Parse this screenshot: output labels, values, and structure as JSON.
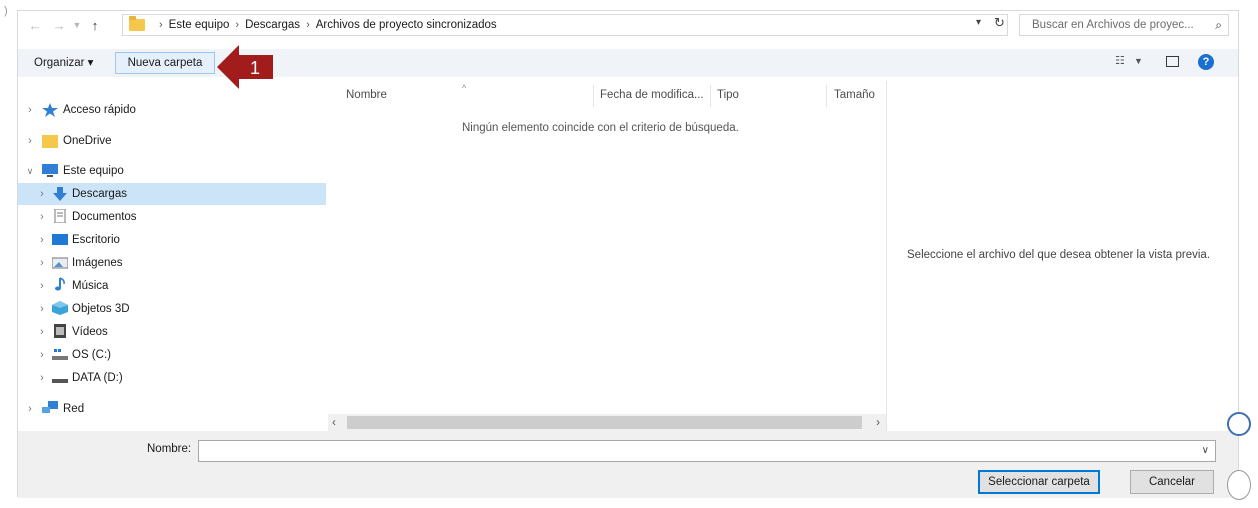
{
  "address_bar": {
    "back_icon": "arrow-left-icon",
    "forward_icon": "arrow-right-icon",
    "recent_icon": "chevron-down-icon",
    "up_icon": "arrow-up-icon",
    "breadcrumbs": [
      "Este equipo",
      "Descargas",
      "Archivos de proyecto sincronizados"
    ],
    "search_placeholder": "Buscar en Archivos de proyec..."
  },
  "toolbar": {
    "organize_label": "Organizar ▾",
    "new_folder_label": "Nueva carpeta",
    "annotation_number": "1"
  },
  "nav_pane": {
    "items": [
      {
        "label": "Acceso rápido",
        "icon": "star-icon",
        "expanded": false,
        "selected": false
      },
      {
        "label": "OneDrive",
        "icon": "folder-icon",
        "expanded": false,
        "selected": false
      },
      {
        "label": "Este equipo",
        "icon": "computer-icon",
        "expanded": true,
        "selected": false
      },
      {
        "label": "Descargas",
        "icon": "download-icon",
        "expanded": false,
        "selected": true
      },
      {
        "label": "Documentos",
        "icon": "document-icon",
        "expanded": false,
        "selected": false
      },
      {
        "label": "Escritorio",
        "icon": "desktop-icon",
        "expanded": false,
        "selected": false
      },
      {
        "label": "Imágenes",
        "icon": "image-icon",
        "expanded": false,
        "selected": false
      },
      {
        "label": "Música",
        "icon": "music-icon",
        "expanded": false,
        "selected": false
      },
      {
        "label": "Objetos 3D",
        "icon": "cube-icon",
        "expanded": false,
        "selected": false
      },
      {
        "label": "Vídeos",
        "icon": "video-icon",
        "expanded": false,
        "selected": false
      },
      {
        "label": "OS (C:)",
        "icon": "drive-c-icon",
        "expanded": false,
        "selected": false
      },
      {
        "label": "DATA (D:)",
        "icon": "drive-d-icon",
        "expanded": false,
        "selected": false
      },
      {
        "label": "Red",
        "icon": "network-icon",
        "expanded": false,
        "selected": false
      }
    ]
  },
  "file_list": {
    "columns": [
      "Nombre",
      "Fecha de modifica...",
      "Tipo",
      "Tamaño"
    ],
    "empty_message": "Ningún elemento coincide con el criterio de búsqueda."
  },
  "preview": {
    "message": "Seleccione el archivo del que desea obtener la vista previa."
  },
  "bottom": {
    "name_label": "Nombre:",
    "name_value": "",
    "select_button": "Seleccionar carpeta",
    "cancel_button": "Cancelar"
  },
  "colors": {
    "selection": "#cce4f7",
    "accent": "#0078d7",
    "annotation": "#a31c1c"
  }
}
